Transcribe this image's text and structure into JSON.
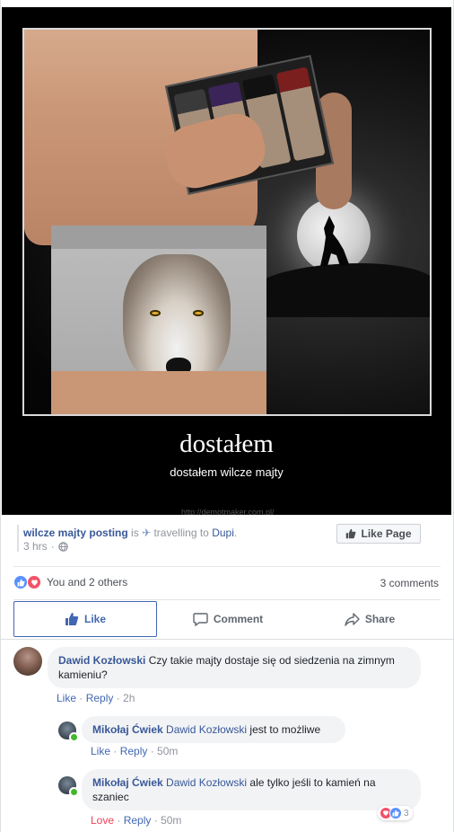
{
  "demotivator": {
    "title": "dostałem",
    "subtitle": "dostałem wilcze majty",
    "url": "http://demotmaker.com.pl/"
  },
  "post": {
    "page_name": "wilcze majty posting",
    "is_text": "is",
    "activity": "travelling to",
    "place": "Dupi",
    "time": "3 hrs",
    "like_page_label": "Like Page"
  },
  "reactions": {
    "summary": "You and 2 others",
    "comments_count": "3 comments"
  },
  "actions": {
    "like": "Like",
    "comment": "Comment",
    "share": "Share"
  },
  "comments": [
    {
      "author": "Dawid Kozłowski",
      "text": "Czy takie majty dostaje się od siedzenia na zimnym kamieniu?",
      "like": "Like",
      "reply": "Reply",
      "time": "2h"
    },
    {
      "author": "Mikołaj Ćwiek",
      "tag": "Dawid Kozłowski",
      "text": "jest to możliwe",
      "like": "Like",
      "reply": "Reply",
      "time": "50m"
    },
    {
      "author": "Mikołaj Ćwiek",
      "tag": "Dawid Kozłowski",
      "text": "ale tylko jeśli to kamień na szaniec",
      "like": "Love",
      "reply": "Reply",
      "time": "50m",
      "reaction_count": "3"
    }
  ],
  "colors": {
    "link": "#385898",
    "like_blue": "#4267b2",
    "love_red": "#f33e58",
    "bubble_bg": "#f2f3f5"
  }
}
